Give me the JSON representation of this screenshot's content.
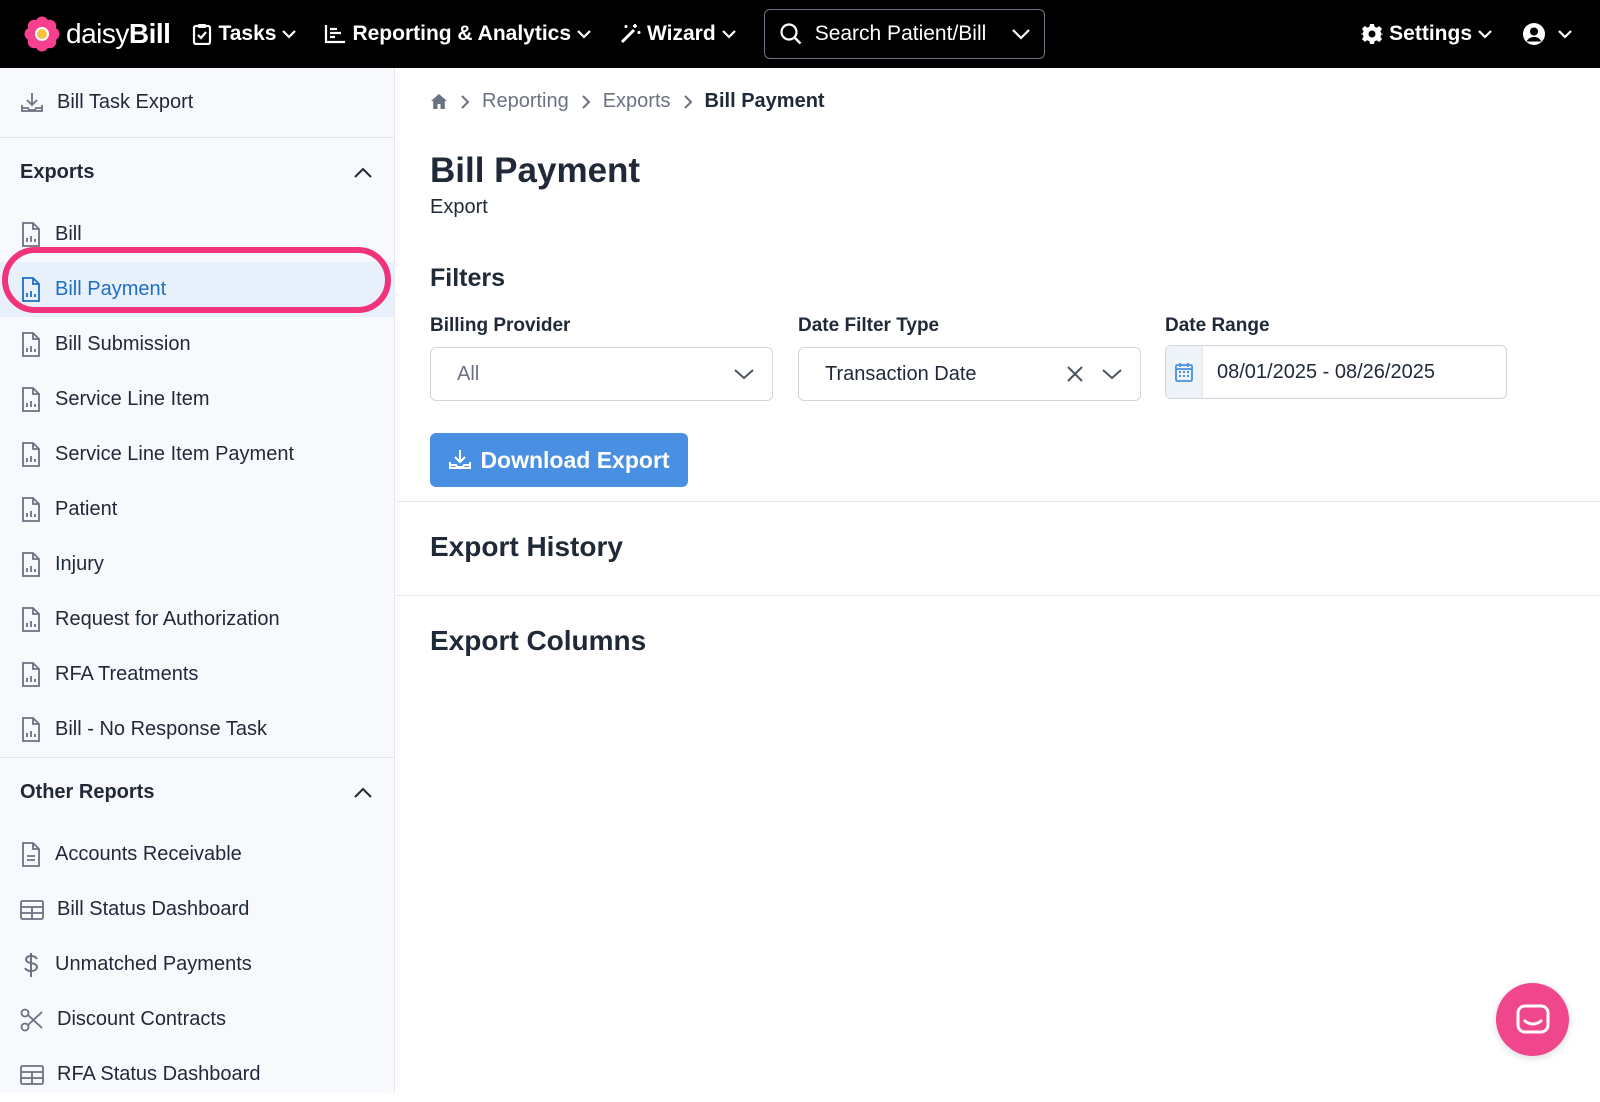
{
  "brand": {
    "name_light": "daisy",
    "name_bold": "Bill"
  },
  "topnav": {
    "tasks": "Tasks",
    "reporting": "Reporting & Analytics",
    "wizard": "Wizard",
    "search_label": "Search Patient/Bill",
    "settings": "Settings"
  },
  "sidebar": {
    "top_item": "Bill Task Export",
    "exports_header": "Exports",
    "exports": [
      {
        "label": "Bill",
        "icon": "document-chart-icon",
        "active": false
      },
      {
        "label": "Bill Payment",
        "icon": "document-chart-icon",
        "active": true
      },
      {
        "label": "Bill Submission",
        "icon": "document-chart-icon",
        "active": false
      },
      {
        "label": "Service Line Item",
        "icon": "document-chart-icon",
        "active": false
      },
      {
        "label": "Service Line Item Payment",
        "icon": "document-chart-icon",
        "active": false
      },
      {
        "label": "Patient",
        "icon": "document-chart-icon",
        "active": false
      },
      {
        "label": "Injury",
        "icon": "document-chart-icon",
        "active": false
      },
      {
        "label": "Request for Authorization",
        "icon": "document-chart-icon",
        "active": false
      },
      {
        "label": "RFA Treatments",
        "icon": "document-chart-icon",
        "active": false
      },
      {
        "label": "Bill - No Response Task",
        "icon": "document-chart-icon",
        "active": false
      }
    ],
    "other_header": "Other Reports",
    "other": [
      {
        "label": "Accounts Receivable",
        "icon": "document-text-icon"
      },
      {
        "label": "Bill Status Dashboard",
        "icon": "table-icon"
      },
      {
        "label": "Unmatched Payments",
        "icon": "dollar-icon"
      },
      {
        "label": "Discount Contracts",
        "icon": "scissors-icon"
      },
      {
        "label": "RFA Status Dashboard",
        "icon": "table-icon"
      }
    ]
  },
  "breadcrumb": {
    "reporting": "Reporting",
    "exports": "Exports",
    "current": "Bill Payment"
  },
  "page": {
    "title": "Bill Payment",
    "subtitle": "Export",
    "filters_title": "Filters",
    "billing_provider_label": "Billing Provider",
    "billing_provider_value": "All",
    "date_filter_type_label": "Date Filter Type",
    "date_filter_type_value": "Transaction Date",
    "date_range_label": "Date Range",
    "date_range_value": "08/01/2025 - 08/26/2025",
    "download_button": "Download Export",
    "export_history": "Export History",
    "export_columns": "Export Columns"
  },
  "colors": {
    "accent": "#4a90e2",
    "active_text": "#1d6fc4",
    "highlight": "#f0337a",
    "chat": "#f0468c"
  }
}
